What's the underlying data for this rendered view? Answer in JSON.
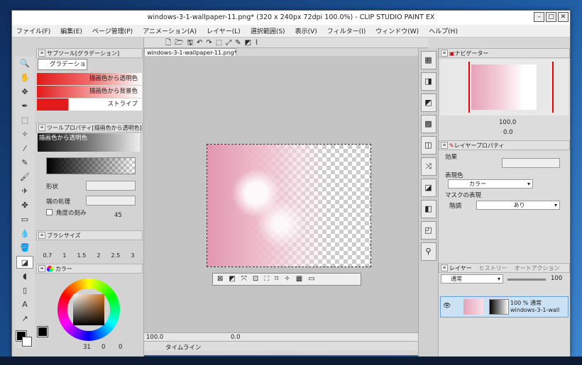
{
  "window": {
    "title": "windows-3-1-wallpaper-11.png* (320 x 240px 72dpi 100.0%) - CLIP STUDIO PAINT EX",
    "min": "–",
    "max": "□",
    "close": "✕"
  },
  "menu": [
    "ファイル(F)",
    "編集(E)",
    "ページ管理(P)",
    "アニメーション(A)",
    "レイヤー(L)",
    "選択範囲(S)",
    "表示(V)",
    "フィルター(I)",
    "ウィンドウ(W)",
    "ヘルプ(H)"
  ],
  "subtool": {
    "header": "サブツール[グラデーション]",
    "tab": "グラデーション",
    "items": [
      "描画色から透明色",
      "描画色から背景色",
      "ストライプ"
    ]
  },
  "toolprop": {
    "header": "ツールプロパティ[描画色から透明色]",
    "preset": "描画色から透明色",
    "shape_label": "形状",
    "edge_label": "端の処理",
    "angle_label": "角度の刻み",
    "angle_value": "45"
  },
  "brushsize": {
    "header": "ブラシサイズ",
    "values": [
      "0.7",
      "1",
      "1.5",
      "2",
      "2.5",
      "3"
    ]
  },
  "color": {
    "header": "カラー",
    "fg": "#000000",
    "bg": "#ffffff",
    "readout": "31",
    "readout2": "0",
    "readout3": "0"
  },
  "canvas": {
    "tab": "windows-3-1-wallpaper-11.png*",
    "zoom": "100.0",
    "angle": "0.0"
  },
  "navigator": {
    "header": "ナビゲーター",
    "zoom": "100.0",
    "angle": "0.0"
  },
  "layerprop": {
    "header": "レイヤープロパティ",
    "effect_label": "効果",
    "expr_label": "表現色",
    "expr_value": "カラー",
    "mask_label": "マスクの表現",
    "tone_label": "階調",
    "tone_value": "あり"
  },
  "layers": {
    "tabs": [
      "レイヤー",
      "ヒストリー",
      "オートアクション"
    ],
    "blend": "通常",
    "opacity": "100",
    "layer_line1": "100 % 通常",
    "layer_line2": "windows-3-1-wall"
  },
  "timeline": {
    "label": "タイムライン"
  }
}
